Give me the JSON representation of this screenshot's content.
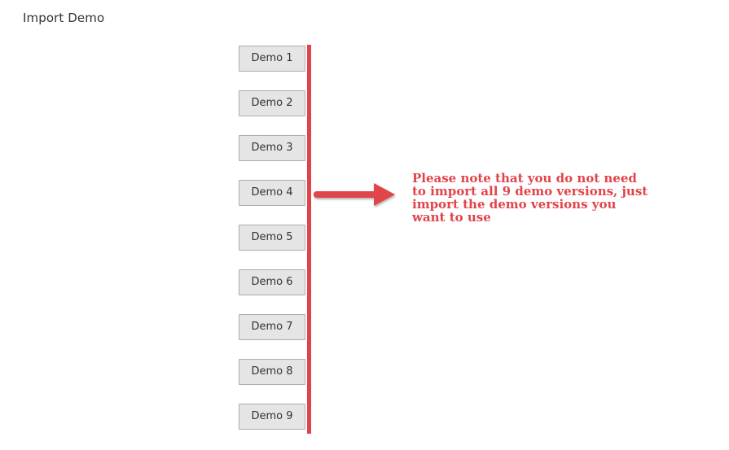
{
  "section": {
    "title": "Import Demo"
  },
  "demos": [
    {
      "label": "Demo 1"
    },
    {
      "label": "Demo 2"
    },
    {
      "label": "Demo 3"
    },
    {
      "label": "Demo 4"
    },
    {
      "label": "Demo 5"
    },
    {
      "label": "Demo 6"
    },
    {
      "label": "Demo 7"
    },
    {
      "label": "Demo 8"
    },
    {
      "label": "Demo 9"
    }
  ],
  "annotation": {
    "lines": [
      "Please note that you do not need",
      "to import all 9 demo versions, just",
      "import the demo versions you",
      "want to use"
    ],
    "color": "#e0444a",
    "arrow_icon": "right-arrow-icon"
  }
}
